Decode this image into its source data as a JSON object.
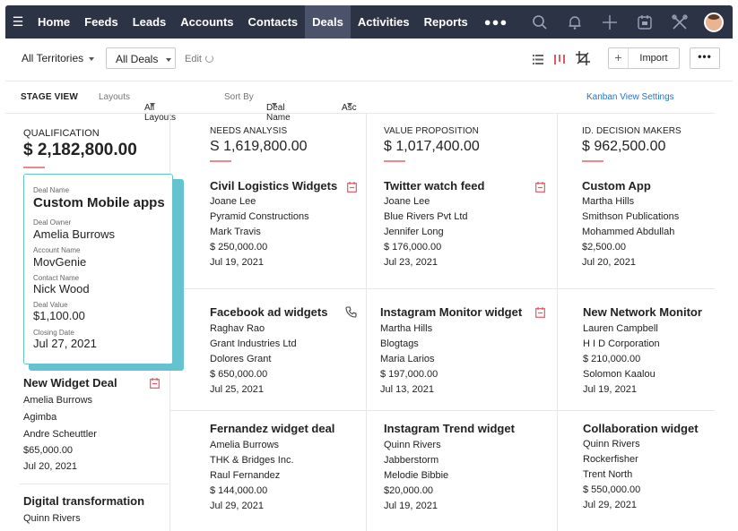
{
  "nav": {
    "items": [
      "Home",
      "Feeds",
      "Leads",
      "Accounts",
      "Contacts",
      "Deals",
      "Activities",
      "Reports"
    ],
    "active": "Deals",
    "more": "●●●",
    "right_icons": [
      "search-icon",
      "bell-icon",
      "plus-icon",
      "calendar-icon",
      "tools-icon",
      "avatar"
    ]
  },
  "toolbar": {
    "territories": "All Territories",
    "deals_filter": "All Deals",
    "edit": "Edit",
    "import": "Import",
    "import_plus": "+",
    "more": "•••"
  },
  "stagebar": {
    "stage_view": "STAGE VIEW",
    "layouts_label": "Layouts",
    "layouts_value": "All Layouts",
    "sort_label": "Sort By",
    "sort_value": "Deal Name",
    "order": "Asc",
    "kanban": "Kanban View Settings"
  },
  "colors": {
    "nav_bg": "#2c3345",
    "accent_teal": "#64c3cf",
    "underline": "#f0858a",
    "link": "#2a73c6"
  },
  "columns": [
    {
      "label": "QUALIFICATION",
      "amount": "$ 2,182,800.00",
      "highlight": {
        "deal_name_label": "Deal Name",
        "deal_name": "Custom Mobile apps",
        "owner_label": "Deal Owner",
        "owner": "Amelia Burrows",
        "account_label": "Account Name",
        "account": "MovGenie",
        "contact_label": "Contact Name",
        "contact": "Nick Wood",
        "value_label": "Deal Value",
        "value": "$1,100.00",
        "closing_label": "Closing Date",
        "closing": "Jul 27, 2021"
      },
      "cards": [
        {
          "title": "New Widget Deal",
          "lines": [
            "Amelia Burrows",
            "Agimba",
            "Andre Scheuttler",
            "$65,000.00",
            "Jul 20, 2021"
          ],
          "icon": "task-icon"
        },
        {
          "title": "Digital transformation",
          "lines": [
            "Quinn Rivers"
          ],
          "icon": ""
        }
      ]
    },
    {
      "label": "NEEDS ANALYSIS",
      "amount": "S 1,619,800.00",
      "cards": [
        {
          "title": "Civil Logistics Widgets",
          "lines": [
            "Joane Lee",
            "Pyramid Constructions",
            "Mark Travis",
            "$ 250,000.00",
            "Jul 19, 2021"
          ],
          "icon": "task-icon"
        },
        {
          "title": "Facebook ad widgets",
          "lines": [
            "Raghav Rao",
            "Grant Industries Ltd",
            "Dolores Grant",
            "$ 650,000.00",
            "Jul 25, 2021"
          ],
          "icon": "phone-icon"
        },
        {
          "title": "Fernandez widget deal",
          "lines": [
            "Amelia Burrows",
            "THK & Bridges Inc.",
            "Raul Fernandez",
            "$ 144,000.00",
            "Jul 29, 2021"
          ],
          "icon": ""
        }
      ]
    },
    {
      "label": "VALUE PROPOSITION",
      "amount": "$ 1,017,400.00",
      "cards": [
        {
          "title": "Twitter watch feed",
          "lines": [
            "Joane Lee",
            "Blue Rivers Pvt Ltd",
            "Jennifer Long",
            "$ 176,000.00",
            "Jul 23, 2021"
          ],
          "icon": "task-icon"
        },
        {
          "title": "Instagram Monitor widget",
          "lines": [
            "Martha Hills",
            "Blogtags",
            "Maria Larios",
            "$ 197,000.00",
            "Jul 13, 2021"
          ],
          "icon": "task-icon"
        },
        {
          "title": "Instagram Trend widget",
          "lines": [
            "Quinn Rivers",
            "Jabberstorm",
            "Melodie Bibbie",
            "$20,000.00",
            "Jul 19, 2021"
          ],
          "icon": ""
        }
      ]
    },
    {
      "label": "ID. DECISION MAKERS",
      "amount": "$ 962,500.00",
      "cards": [
        {
          "title": "Custom App",
          "lines": [
            "Martha Hills",
            "Smithson Publications",
            "Mohammed Abdullah",
            "$2,500.00",
            "Jul 20, 2021"
          ],
          "icon": ""
        },
        {
          "title": "New Network Monitor",
          "lines": [
            "Lauren Campbell",
            "H I D Corporation",
            "$ 210,000.00",
            "Solomon Kaalou",
            "Jul 19, 2021"
          ],
          "icon": ""
        },
        {
          "title": "Collaboration widget",
          "lines": [
            "Quinn Rivers",
            "Rockerfisher",
            "Trent North",
            "$ 550,000.00",
            "Jul 29, 2021"
          ],
          "icon": ""
        }
      ]
    }
  ]
}
